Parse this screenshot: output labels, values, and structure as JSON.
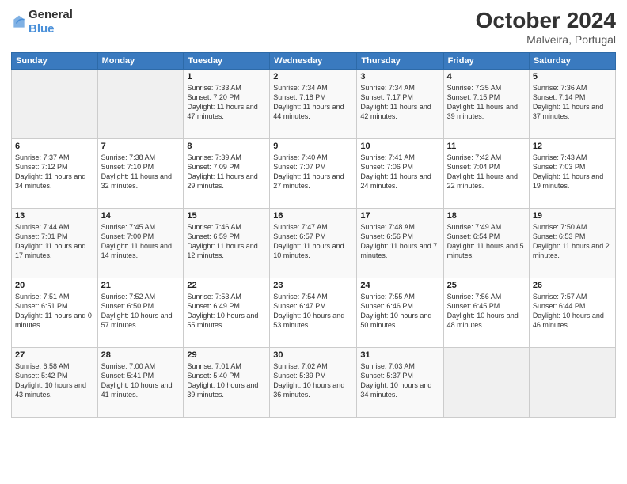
{
  "header": {
    "logo": {
      "general": "General",
      "blue": "Blue"
    },
    "month": "October 2024",
    "location": "Malveira, Portugal"
  },
  "weekdays": [
    "Sunday",
    "Monday",
    "Tuesday",
    "Wednesday",
    "Thursday",
    "Friday",
    "Saturday"
  ],
  "weeks": [
    [
      {
        "day": "",
        "sunrise": "",
        "sunset": "",
        "daylight": ""
      },
      {
        "day": "",
        "sunrise": "",
        "sunset": "",
        "daylight": ""
      },
      {
        "day": "1",
        "sunrise": "Sunrise: 7:33 AM",
        "sunset": "Sunset: 7:20 PM",
        "daylight": "Daylight: 11 hours and 47 minutes."
      },
      {
        "day": "2",
        "sunrise": "Sunrise: 7:34 AM",
        "sunset": "Sunset: 7:18 PM",
        "daylight": "Daylight: 11 hours and 44 minutes."
      },
      {
        "day": "3",
        "sunrise": "Sunrise: 7:34 AM",
        "sunset": "Sunset: 7:17 PM",
        "daylight": "Daylight: 11 hours and 42 minutes."
      },
      {
        "day": "4",
        "sunrise": "Sunrise: 7:35 AM",
        "sunset": "Sunset: 7:15 PM",
        "daylight": "Daylight: 11 hours and 39 minutes."
      },
      {
        "day": "5",
        "sunrise": "Sunrise: 7:36 AM",
        "sunset": "Sunset: 7:14 PM",
        "daylight": "Daylight: 11 hours and 37 minutes."
      }
    ],
    [
      {
        "day": "6",
        "sunrise": "Sunrise: 7:37 AM",
        "sunset": "Sunset: 7:12 PM",
        "daylight": "Daylight: 11 hours and 34 minutes."
      },
      {
        "day": "7",
        "sunrise": "Sunrise: 7:38 AM",
        "sunset": "Sunset: 7:10 PM",
        "daylight": "Daylight: 11 hours and 32 minutes."
      },
      {
        "day": "8",
        "sunrise": "Sunrise: 7:39 AM",
        "sunset": "Sunset: 7:09 PM",
        "daylight": "Daylight: 11 hours and 29 minutes."
      },
      {
        "day": "9",
        "sunrise": "Sunrise: 7:40 AM",
        "sunset": "Sunset: 7:07 PM",
        "daylight": "Daylight: 11 hours and 27 minutes."
      },
      {
        "day": "10",
        "sunrise": "Sunrise: 7:41 AM",
        "sunset": "Sunset: 7:06 PM",
        "daylight": "Daylight: 11 hours and 24 minutes."
      },
      {
        "day": "11",
        "sunrise": "Sunrise: 7:42 AM",
        "sunset": "Sunset: 7:04 PM",
        "daylight": "Daylight: 11 hours and 22 minutes."
      },
      {
        "day": "12",
        "sunrise": "Sunrise: 7:43 AM",
        "sunset": "Sunset: 7:03 PM",
        "daylight": "Daylight: 11 hours and 19 minutes."
      }
    ],
    [
      {
        "day": "13",
        "sunrise": "Sunrise: 7:44 AM",
        "sunset": "Sunset: 7:01 PM",
        "daylight": "Daylight: 11 hours and 17 minutes."
      },
      {
        "day": "14",
        "sunrise": "Sunrise: 7:45 AM",
        "sunset": "Sunset: 7:00 PM",
        "daylight": "Daylight: 11 hours and 14 minutes."
      },
      {
        "day": "15",
        "sunrise": "Sunrise: 7:46 AM",
        "sunset": "Sunset: 6:59 PM",
        "daylight": "Daylight: 11 hours and 12 minutes."
      },
      {
        "day": "16",
        "sunrise": "Sunrise: 7:47 AM",
        "sunset": "Sunset: 6:57 PM",
        "daylight": "Daylight: 11 hours and 10 minutes."
      },
      {
        "day": "17",
        "sunrise": "Sunrise: 7:48 AM",
        "sunset": "Sunset: 6:56 PM",
        "daylight": "Daylight: 11 hours and 7 minutes."
      },
      {
        "day": "18",
        "sunrise": "Sunrise: 7:49 AM",
        "sunset": "Sunset: 6:54 PM",
        "daylight": "Daylight: 11 hours and 5 minutes."
      },
      {
        "day": "19",
        "sunrise": "Sunrise: 7:50 AM",
        "sunset": "Sunset: 6:53 PM",
        "daylight": "Daylight: 11 hours and 2 minutes."
      }
    ],
    [
      {
        "day": "20",
        "sunrise": "Sunrise: 7:51 AM",
        "sunset": "Sunset: 6:51 PM",
        "daylight": "Daylight: 11 hours and 0 minutes."
      },
      {
        "day": "21",
        "sunrise": "Sunrise: 7:52 AM",
        "sunset": "Sunset: 6:50 PM",
        "daylight": "Daylight: 10 hours and 57 minutes."
      },
      {
        "day": "22",
        "sunrise": "Sunrise: 7:53 AM",
        "sunset": "Sunset: 6:49 PM",
        "daylight": "Daylight: 10 hours and 55 minutes."
      },
      {
        "day": "23",
        "sunrise": "Sunrise: 7:54 AM",
        "sunset": "Sunset: 6:47 PM",
        "daylight": "Daylight: 10 hours and 53 minutes."
      },
      {
        "day": "24",
        "sunrise": "Sunrise: 7:55 AM",
        "sunset": "Sunset: 6:46 PM",
        "daylight": "Daylight: 10 hours and 50 minutes."
      },
      {
        "day": "25",
        "sunrise": "Sunrise: 7:56 AM",
        "sunset": "Sunset: 6:45 PM",
        "daylight": "Daylight: 10 hours and 48 minutes."
      },
      {
        "day": "26",
        "sunrise": "Sunrise: 7:57 AM",
        "sunset": "Sunset: 6:44 PM",
        "daylight": "Daylight: 10 hours and 46 minutes."
      }
    ],
    [
      {
        "day": "27",
        "sunrise": "Sunrise: 6:58 AM",
        "sunset": "Sunset: 5:42 PM",
        "daylight": "Daylight: 10 hours and 43 minutes."
      },
      {
        "day": "28",
        "sunrise": "Sunrise: 7:00 AM",
        "sunset": "Sunset: 5:41 PM",
        "daylight": "Daylight: 10 hours and 41 minutes."
      },
      {
        "day": "29",
        "sunrise": "Sunrise: 7:01 AM",
        "sunset": "Sunset: 5:40 PM",
        "daylight": "Daylight: 10 hours and 39 minutes."
      },
      {
        "day": "30",
        "sunrise": "Sunrise: 7:02 AM",
        "sunset": "Sunset: 5:39 PM",
        "daylight": "Daylight: 10 hours and 36 minutes."
      },
      {
        "day": "31",
        "sunrise": "Sunrise: 7:03 AM",
        "sunset": "Sunset: 5:37 PM",
        "daylight": "Daylight: 10 hours and 34 minutes."
      },
      {
        "day": "",
        "sunrise": "",
        "sunset": "",
        "daylight": ""
      },
      {
        "day": "",
        "sunrise": "",
        "sunset": "",
        "daylight": ""
      }
    ]
  ]
}
